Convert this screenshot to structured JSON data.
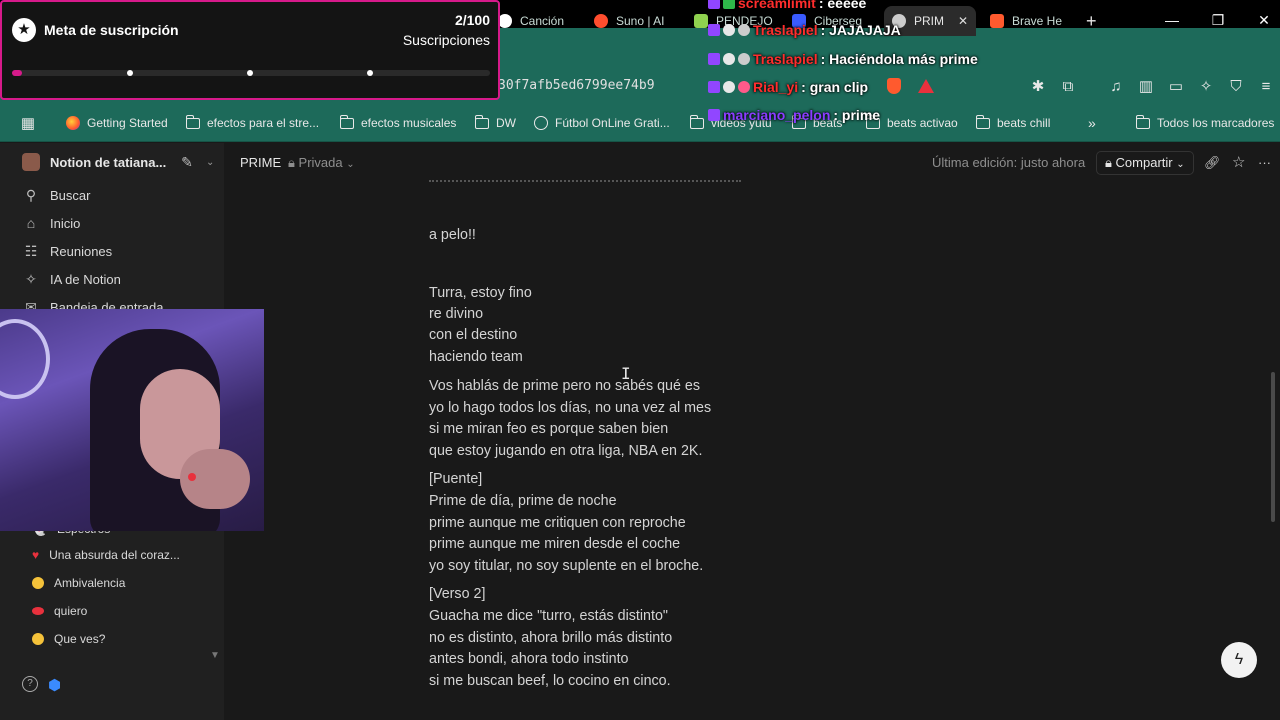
{
  "overlay": {
    "title": "Meta de suscripción",
    "count": "2/100",
    "subtitle": "Suscripciones",
    "progress": 0.02
  },
  "chat": [
    {
      "user": "screamlimit",
      "message": ": eeeee",
      "color": "#ff2d2d"
    },
    {
      "user": "Traslapiel",
      "message": ": JAJAJAJA",
      "color": "#ff2d2d"
    },
    {
      "user": "Traslapiel",
      "message": ": Haciéndola más prime",
      "color": "#ff2d2d"
    },
    {
      "user": "Rial_yi",
      "message": ": gran clip",
      "color": "#ff2d2d"
    },
    {
      "user": "marciano_pelon",
      "message": ": prime",
      "color": "#8a3dff"
    }
  ],
  "browser": {
    "tabs": [
      {
        "label": "Canción",
        "color": "#ffffff"
      },
      {
        "label": "Suno | AI",
        "color": "#ff4d2e"
      },
      {
        "label": "PENDEJO",
        "color": "#8fd14f"
      },
      {
        "label": "Ciberseg",
        "color": "#3a5bff"
      },
      {
        "label": "PRIM",
        "color": "#cccccc"
      },
      {
        "label": "Brave He",
        "color": "#ff5a2e"
      }
    ],
    "url": "30f7afb5ed6799ee74b9",
    "window_controls": [
      "—",
      "❐",
      "✕"
    ],
    "bookmarks": [
      {
        "label": "Getting Started",
        "icon": "firefox-icon"
      },
      {
        "label": "efectos para el stre...",
        "icon": "folder-icon"
      },
      {
        "label": "efectos musicales",
        "icon": "folder-icon"
      },
      {
        "label": "DW",
        "icon": "folder-icon"
      },
      {
        "label": "Fútbol OnLine Grati...",
        "icon": "globe-icon"
      },
      {
        "label": "videos yutu",
        "icon": "folder-icon"
      },
      {
        "label": "beats",
        "icon": "folder-icon"
      },
      {
        "label": "beats activao",
        "icon": "folder-icon"
      },
      {
        "label": "beats chill",
        "icon": "folder-icon"
      },
      {
        "label": "Todos los marcadores",
        "icon": "folder-icon"
      }
    ]
  },
  "sidebar": {
    "workspace": "Notion de tatiana...",
    "nav": [
      {
        "label": "Buscar",
        "icon": "search-icon"
      },
      {
        "label": "Inicio",
        "icon": "home-icon"
      },
      {
        "label": "Reuniones",
        "icon": "meetings-icon"
      },
      {
        "label": "IA de Notion",
        "icon": "ai-icon"
      },
      {
        "label": "Bandeja de entrada",
        "icon": "inbox-icon"
      }
    ],
    "pages": [
      {
        "label": "Espectros",
        "emoji": "👻"
      },
      {
        "label": "Una absurda del coraz...",
        "emoji": "❤️"
      },
      {
        "label": "Ambivalencia",
        "emoji": "😐"
      },
      {
        "label": "quiero",
        "emoji": "👄"
      },
      {
        "label": "Que ves?",
        "emoji": "😟"
      }
    ]
  },
  "page": {
    "title": "PRIME",
    "privacy": "Privada",
    "last_edit": "Última edición: justo ahora",
    "share": "Compartir",
    "lines": [
      "a pelo!!",
      "Turra, estoy fino",
      "re divino",
      "con el destino",
      "haciendo team",
      "Vos hablás de prime pero no sabés qué es",
      "yo lo hago todos los días, no una vez al mes",
      "si me miran feo es porque saben bien",
      "que estoy jugando en otra liga, NBA en 2K.",
      "[Puente]",
      "Prime de día, prime de noche",
      "prime aunque me critiquen con reproche",
      "prime aunque me miren desde el coche",
      "yo soy titular, no soy suplente en el broche.",
      "[Verso 2]",
      "Guacha me dice \"turro, estás distinto\"",
      "no es distinto, ahora brillo más distinto",
      "antes bondi, ahora todo instinto",
      "si me buscan beef, lo cocino en cinco."
    ]
  }
}
